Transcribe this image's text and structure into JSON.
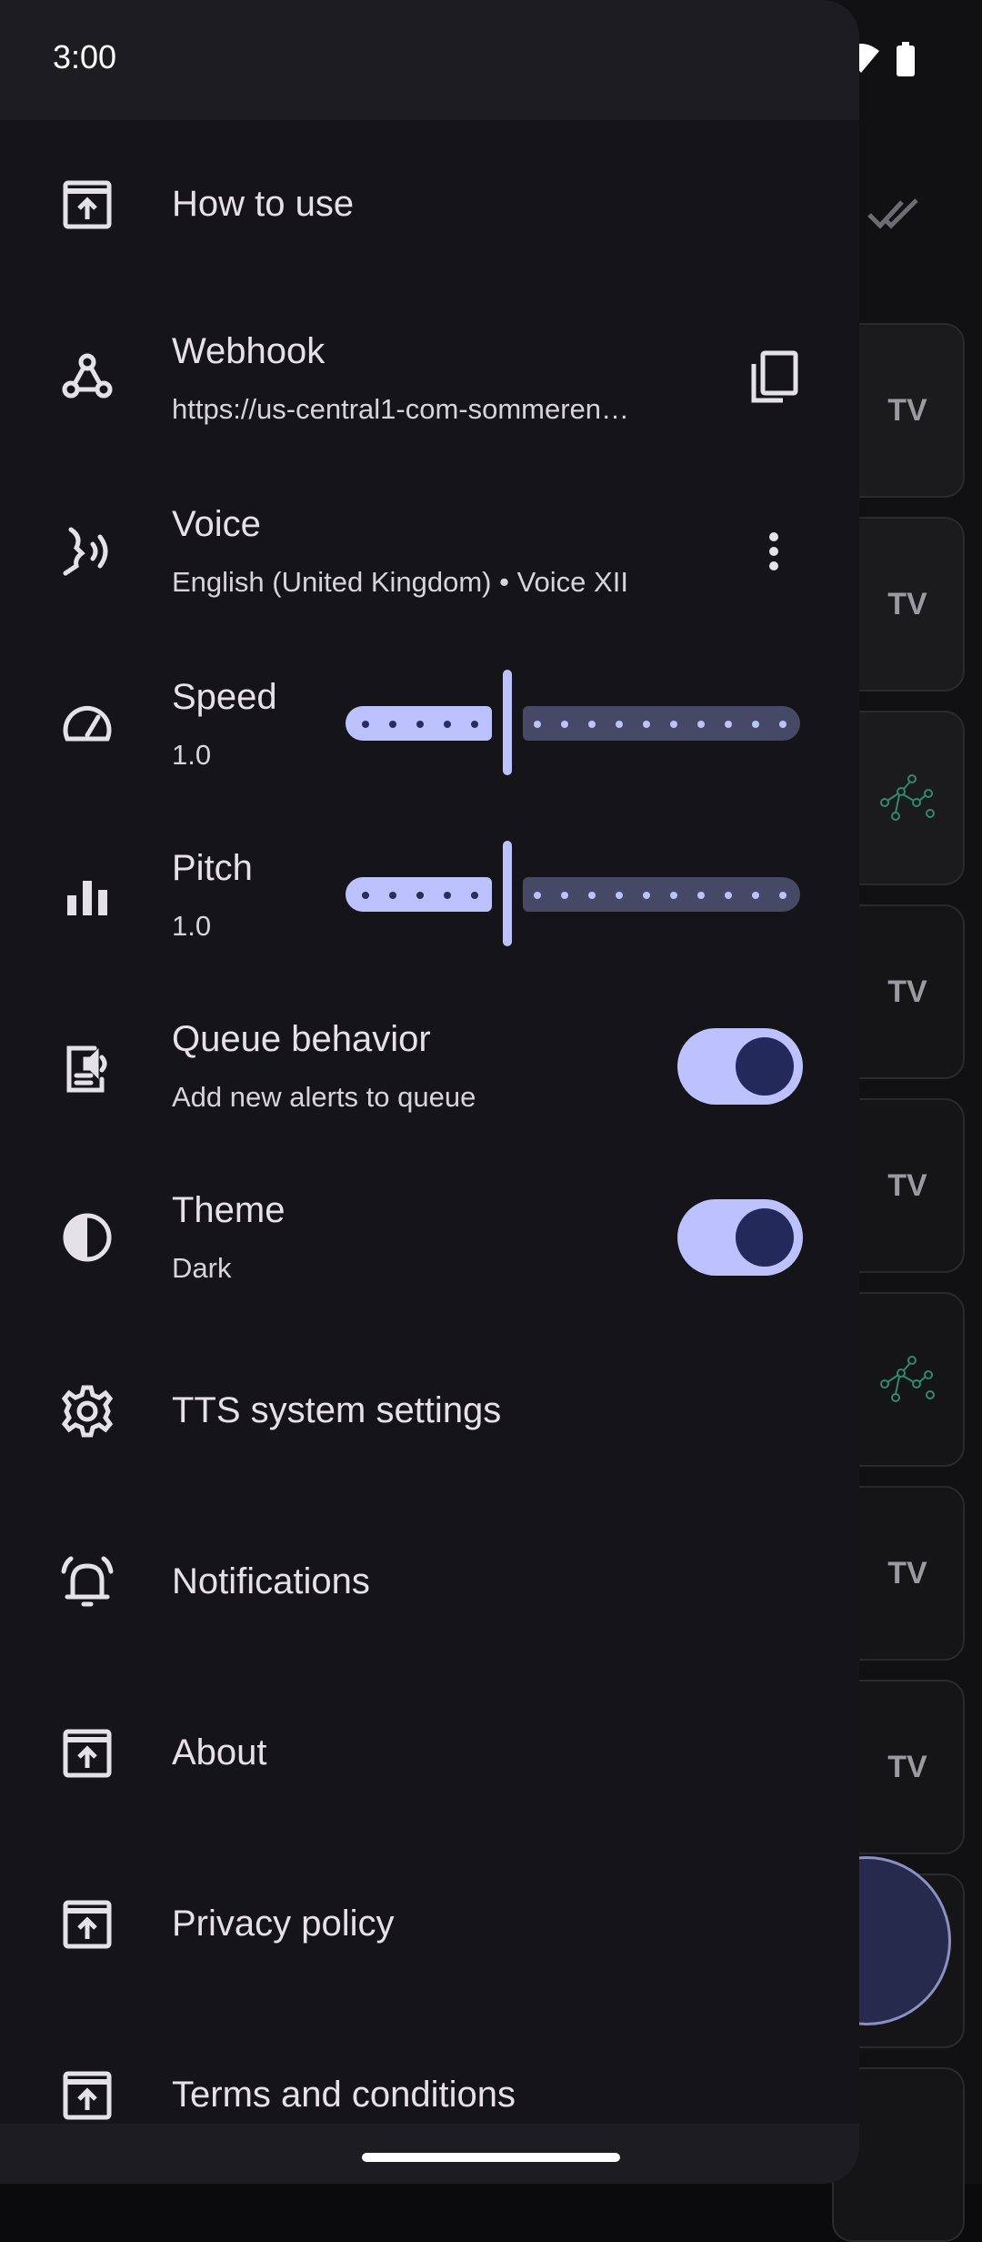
{
  "status_bar": {
    "time": "3:00"
  },
  "drawer": {
    "items": [
      {
        "key": "how_to_use",
        "title": "How to use",
        "icon": "open-in-new-icon"
      },
      {
        "key": "webhook",
        "title": "Webhook",
        "subtitle": "https://us-central1-com-sommeren…",
        "icon": "webhook-icon",
        "action_icon": "copy-icon"
      },
      {
        "key": "voice",
        "title": "Voice",
        "subtitle": "English (United Kingdom) • Voice XII",
        "icon": "voice-icon",
        "action_icon": "more-vert-icon"
      },
      {
        "key": "speed",
        "title": "Speed",
        "subtitle": "1.0",
        "icon": "speed-icon",
        "slider_fraction": 0.33
      },
      {
        "key": "pitch",
        "title": "Pitch",
        "subtitle": "1.0",
        "icon": "bar-chart-icon",
        "slider_fraction": 0.33
      },
      {
        "key": "queue",
        "title": "Queue behavior",
        "subtitle": "Add new alerts to queue",
        "icon": "queue-speaker-icon",
        "toggle_on": true
      },
      {
        "key": "theme",
        "title": "Theme",
        "subtitle": "Dark",
        "icon": "contrast-icon",
        "toggle_on": true
      },
      {
        "key": "tts",
        "title": "TTS system settings",
        "icon": "gear-icon"
      },
      {
        "key": "notifications",
        "title": "Notifications",
        "icon": "alarm-bell-icon"
      },
      {
        "key": "about",
        "title": "About",
        "icon": "open-in-new-icon"
      },
      {
        "key": "privacy",
        "title": "Privacy policy",
        "icon": "open-in-new-icon"
      },
      {
        "key": "terms",
        "title": "Terms and conditions",
        "icon": "open-in-new-icon"
      }
    ]
  },
  "colors": {
    "drawer_bg": "#151519",
    "accent": "#bcc2ff",
    "accent_dark": "#24295c",
    "track_inactive": "#454966",
    "text_primary": "#e6e1e9"
  }
}
